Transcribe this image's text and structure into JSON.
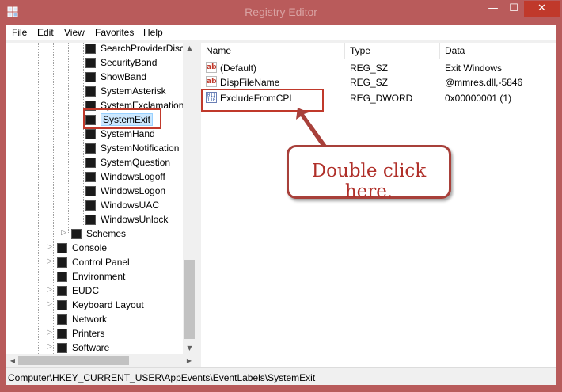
{
  "window": {
    "title": "Registry Editor",
    "controls": {
      "minimize": "—",
      "maximize": "☐",
      "close": "✕"
    }
  },
  "menu": [
    "File",
    "Edit",
    "View",
    "Favorites",
    "Help"
  ],
  "tree": {
    "items": [
      {
        "label": "SearchProviderDisc",
        "level": 3
      },
      {
        "label": "SecurityBand",
        "level": 3
      },
      {
        "label": "ShowBand",
        "level": 3
      },
      {
        "label": "SystemAsterisk",
        "level": 3
      },
      {
        "label": "SystemExclamation",
        "level": 3
      },
      {
        "label": "SystemExit",
        "level": 3,
        "selected": true
      },
      {
        "label": "SystemHand",
        "level": 3
      },
      {
        "label": "SystemNotification",
        "level": 3
      },
      {
        "label": "SystemQuestion",
        "level": 3
      },
      {
        "label": "WindowsLogoff",
        "level": 3
      },
      {
        "label": "WindowsLogon",
        "level": 3
      },
      {
        "label": "WindowsUAC",
        "level": 3
      },
      {
        "label": "WindowsUnlock",
        "level": 3
      },
      {
        "label": "Schemes",
        "level": 2,
        "expandable": true
      },
      {
        "label": "Console",
        "level": 1,
        "expandable": true
      },
      {
        "label": "Control Panel",
        "level": 1,
        "expandable": true
      },
      {
        "label": "Environment",
        "level": 1,
        "expandable": false
      },
      {
        "label": "EUDC",
        "level": 1,
        "expandable": true
      },
      {
        "label": "Keyboard Layout",
        "level": 1,
        "expandable": true
      },
      {
        "label": "Network",
        "level": 1,
        "expandable": false
      },
      {
        "label": "Printers",
        "level": 1,
        "expandable": true
      },
      {
        "label": "Software",
        "level": 1,
        "expandable": true
      }
    ]
  },
  "values": {
    "columns": [
      "Name",
      "Type",
      "Data"
    ],
    "rows": [
      {
        "name": "(Default)",
        "type": "REG_SZ",
        "data": "Exit Windows",
        "icon": "string-value-icon"
      },
      {
        "name": "DispFileName",
        "type": "REG_SZ",
        "data": "@mmres.dll,-5846",
        "icon": "string-value-icon"
      },
      {
        "name": "ExcludeFromCPL",
        "type": "REG_DWORD",
        "data": "0x00000001 (1)",
        "icon": "binary-value-icon"
      }
    ]
  },
  "icons": {
    "string": "ab",
    "binary": "011\n110"
  },
  "status": {
    "path": "Computer\\HKEY_CURRENT_USER\\AppEvents\\EventLabels\\SystemExit"
  },
  "callout": {
    "text": "Double click here."
  },
  "colors": {
    "titlebar": "#b95b5b",
    "highlight": "#c0392b",
    "callout_text": "#b0302a"
  }
}
